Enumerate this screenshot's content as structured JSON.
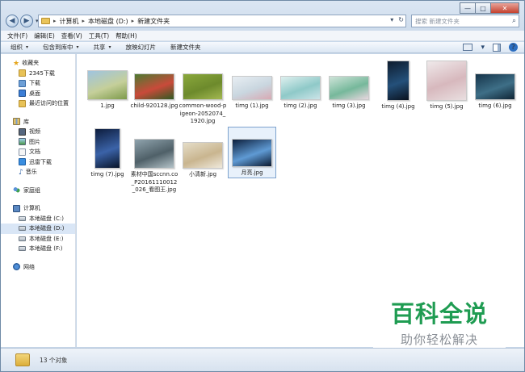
{
  "window": {
    "controls": {
      "minimize": "—",
      "maximize": "□",
      "close": "✕"
    }
  },
  "address": {
    "crumbs": [
      "计算机",
      "本地磁盘 (D:)",
      "新建文件夹"
    ],
    "separator": "▸",
    "dropdown": "▾",
    "refresh": "↻"
  },
  "search": {
    "placeholder": "搜索 新建文件夹"
  },
  "menu": [
    "文件(F)",
    "编辑(E)",
    "查看(V)",
    "工具(T)",
    "帮助(H)"
  ],
  "toolbar": {
    "organize": "组织",
    "include": "包含到库中",
    "share": "共享",
    "slideshow": "放映幻灯片",
    "new_folder": "新建文件夹",
    "dropdown_arrow": "▾",
    "help": "?"
  },
  "sidebar": {
    "favorites": {
      "title": "收藏夹",
      "items": [
        "2345下载",
        "下载",
        "桌面",
        "最近访问的位置"
      ]
    },
    "libraries": {
      "title": "库",
      "items": [
        "视频",
        "图片",
        "文档",
        "迅雷下载",
        "音乐"
      ]
    },
    "homegroup": {
      "title": "家庭组"
    },
    "computer": {
      "title": "计算机",
      "items": [
        "本地磁盘 (C:)",
        "本地磁盘 (D:)",
        "本地磁盘 (E:)",
        "本地磁盘 (F:)"
      ],
      "selected_index": 1
    },
    "network": {
      "title": "网络"
    }
  },
  "files": [
    {
      "name": "1.jpg",
      "colors": [
        "#9fc4e0",
        "#c5cf9a",
        "#7d9a4a"
      ]
    },
    {
      "name": "child-920128.jpg",
      "colors": [
        "#4d7a32",
        "#c94a3a",
        "#2f5a22"
      ]
    },
    {
      "name": "common-wood-pigeon-2052074_1920.jpg",
      "colors": [
        "#8aa83c",
        "#6d8a2c",
        "#a3b851"
      ]
    },
    {
      "name": "timg (1).jpg",
      "colors": [
        "#e8eef3",
        "#c9d6df",
        "#d8a9b3"
      ]
    },
    {
      "name": "timg (2).jpg",
      "colors": [
        "#dff0ef",
        "#8fc9c8",
        "#cce4e8"
      ]
    },
    {
      "name": "timg (3).jpg",
      "colors": [
        "#cfe4d9",
        "#76b89b",
        "#e8d7df"
      ]
    },
    {
      "name": "timg (4).jpg",
      "colors": [
        "#0e1c2e",
        "#24507a",
        "#0a121e"
      ]
    },
    {
      "name": "timg (5).jpg",
      "colors": [
        "#efe9ea",
        "#d7b8bd",
        "#e9dfe0"
      ]
    },
    {
      "name": "timg (6).jpg",
      "colors": [
        "#16344a",
        "#3e6f87",
        "#0f2434"
      ]
    },
    {
      "name": "timg (7).jpg",
      "colors": [
        "#0d1d3d",
        "#3b63a8",
        "#081428"
      ]
    },
    {
      "name": "素材中国sccnn.co_P20161110012_026_看图王.jpg",
      "colors": [
        "#8fa3ad",
        "#4f6068",
        "#b4c3c9"
      ]
    },
    {
      "name": "小清新.jpg",
      "colors": [
        "#e5ddc8",
        "#c9b58f",
        "#efe9dc"
      ]
    },
    {
      "name": "月亮.jpg",
      "colors": [
        "#0c1f3c",
        "#5f9ad4",
        "#0a1930"
      ]
    }
  ],
  "selected_file": "月亮.jpg",
  "status": {
    "count_text": "13 个对象"
  },
  "watermark": {
    "title": "百科全说",
    "subtitle": "助你轻松解决"
  },
  "colors": {
    "accent": "#2c6ec0",
    "selection": "#e8f1fb",
    "watermark_green": "#1f9c52"
  }
}
